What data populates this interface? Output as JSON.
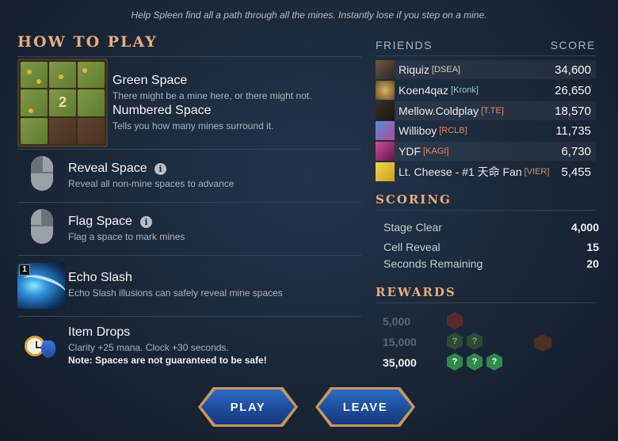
{
  "subtitle": "Help Spleen find all a path through all the mines. Instantly lose if you step on a mine.",
  "how_to_play": {
    "heading": "HOW TO PLAY",
    "grid_number": "2",
    "green_space": {
      "title": "Green Space",
      "desc": "There might be a mine here, or there might not."
    },
    "numbered_space": {
      "title": "Numbered Space",
      "desc": "Tells you how many mines surround it."
    },
    "reveal_space": {
      "title": "Reveal Space",
      "desc": "Reveal all non-mine spaces to advance",
      "icon": "mouse-left-click-icon"
    },
    "flag_space": {
      "title": "Flag Space",
      "desc": "Flag a space to mark mines",
      "icon": "mouse-right-click-icon"
    },
    "echo_slash": {
      "title": "Echo Slash",
      "desc": "Echo Slash illusions can safely reveal mine spaces",
      "badge": "1"
    },
    "item_drops": {
      "title": "Item Drops",
      "desc": "Clarity +25 mana. Clock +30 seconds.",
      "note": "Note: Spaces are not guaranteed to be safe!"
    },
    "info_glyph": "i"
  },
  "friends": {
    "header_label": "FRIENDS",
    "score_label": "SCORE",
    "rows": [
      {
        "name": "Riquiz",
        "tag": "[DSEA]",
        "tag_color": "#d9c9a8",
        "score": "34,600"
      },
      {
        "name": "Koen4qaz",
        "tag": "[Kronk]",
        "tag_color": "#8fd3c8",
        "score": "26,650"
      },
      {
        "name": "Mellow.Coldplay",
        "tag": "[T.TE]",
        "tag_color": "#e08a6a",
        "score": "18,570"
      },
      {
        "name": "Williboy",
        "tag": "[RCLB]",
        "tag_color": "#e08a6a",
        "score": "11,735"
      },
      {
        "name": "YDF",
        "tag": "[KAGI]",
        "tag_color": "#e08a6a",
        "score": "6,730"
      },
      {
        "name": "Lt. Cheese - #1 天命 Fan",
        "tag": "[VIER]",
        "tag_color": "#e08a6a",
        "score": "5,455"
      }
    ]
  },
  "scoring": {
    "heading": "SCORING",
    "items": [
      {
        "label": "Stage Clear",
        "value": "4,000"
      },
      {
        "label": "Cell Reveal",
        "value": "15"
      },
      {
        "label": "Seconds Remaining",
        "value": "20"
      }
    ]
  },
  "rewards": {
    "heading": "REWARDS",
    "tiers": [
      {
        "threshold": "5,000",
        "color": "#5b6470"
      },
      {
        "threshold": "15,000",
        "color": "#5b6470"
      },
      {
        "threshold": "35,000",
        "color": "#eef1f5"
      }
    ],
    "hex_glyph": "?"
  },
  "buttons": {
    "play": "PLAY",
    "leave": "LEAVE"
  }
}
